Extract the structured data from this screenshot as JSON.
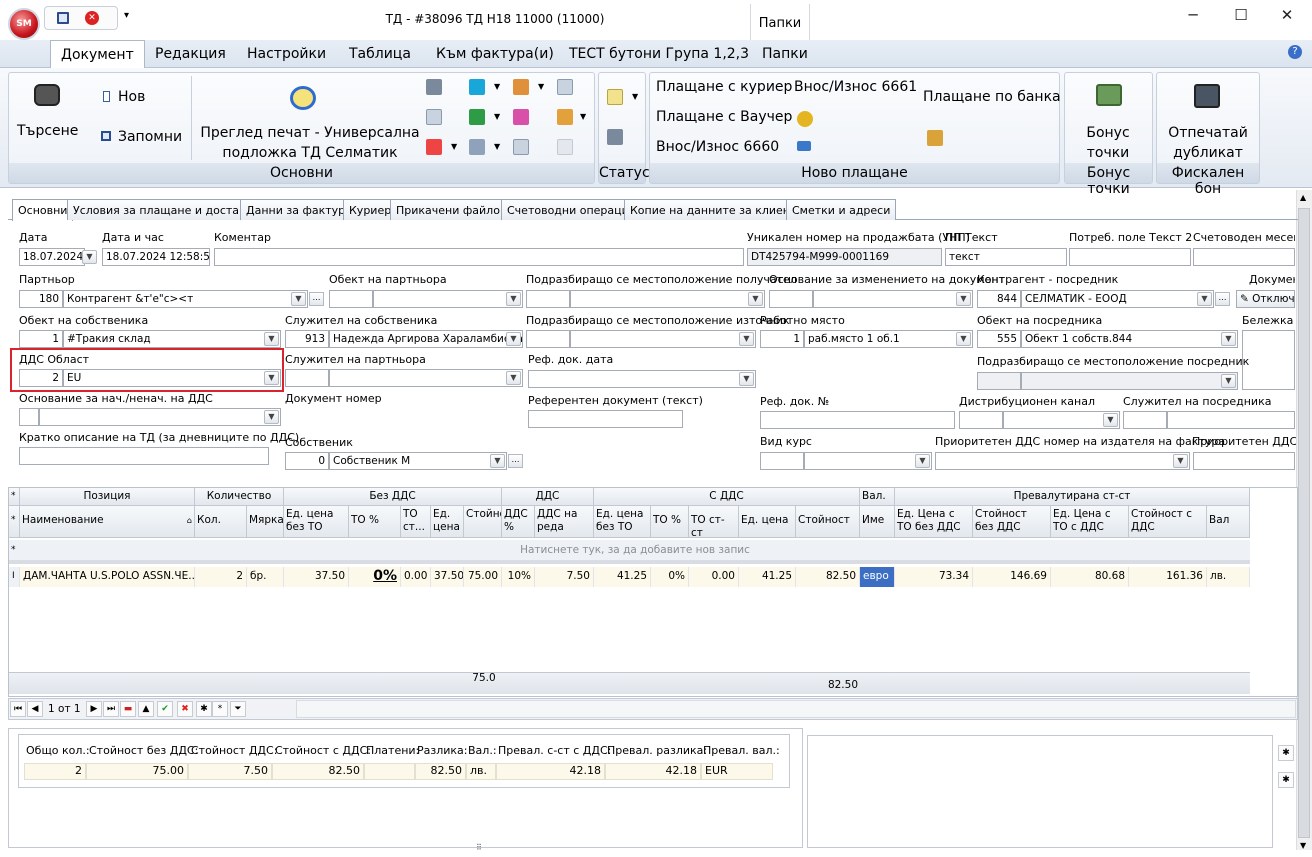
{
  "window": {
    "title": "ТД - #38096 ТД Н18 11000 (11000)",
    "logo": "SM",
    "papki": "Папки"
  },
  "menu": [
    "Документ",
    "Редакция",
    "Настройки",
    "Таблица",
    "Към фактура(и)",
    "ТЕСТ бутони Група 1,2,3",
    "Папки"
  ],
  "ribbon": {
    "search": "Търсене",
    "new": "Нов",
    "save": "Запомни",
    "preview": "Преглед печат - Универсална подложка ТД Селматик",
    "grp_main": "Основни",
    "grp_status": "Статус",
    "pay_courier": "Плащане с куриер",
    "pay_voucher": "Плащане с Ваучер",
    "inout1": "Внос/Износ 6660",
    "inout2": "Внос/Износ 6661",
    "pay_bank": "Плащане по банка",
    "grp_newpay": "Ново плащане",
    "bonus": "Бонус точки",
    "grp_bonus": "Бонус точки",
    "print_dup": "Отпечатай дубликат",
    "grp_fiscal": "Фискален бон"
  },
  "tabs": [
    "Основни",
    "Условия за плащане и доставка",
    "Данни за фактура",
    "Куриер",
    "Прикачени файлове",
    "Счетоводни операции",
    "Копие на данните за клиента",
    "Сметки и адреси"
  ],
  "form": {
    "date_lbl": "Дата",
    "date": "18.07.2024",
    "datetime_lbl": "Дата и час",
    "datetime": "18.07.2024 12:58:56",
    "comment_lbl": "Коментар",
    "unp_lbl": "Уникален номер на продажбата (УНП)",
    "unp": "DT425794-M999-0001169",
    "pptext_lbl": "ПП Текст",
    "pptext": "текст",
    "user_text2_lbl": "Потреб. поле Текст 2",
    "acc_month_lbl": "Счетоводен месец з",
    "partner_lbl": "Партньор",
    "partner_code": "180",
    "partner": "Контрагент &т'е\"с><т",
    "partner_obj_lbl": "Обект на партньора",
    "sub_loc_recv_lbl": "Подразбиращо се местоположение получател",
    "reason_lbl": "Основание за изменението на документ",
    "mediator_lbl": "Контрагент - посредник",
    "mediator_code": "844",
    "mediator": "СЕЛМАТИК - ЕООД",
    "doc_lbl": "Докумен",
    "switch_off": "Отключ",
    "own_obj_lbl": "Обект на собственика",
    "own_obj_code": "1",
    "own_obj": "#Тракия склад",
    "own_emp_lbl": "Служител на собственика",
    "own_emp_code": "913",
    "own_emp": "Надежда Аргирова Хараламбиева",
    "sub_loc_src_lbl": "Подразбиращо се местоположение източник",
    "workplace_lbl": "Работно място",
    "workplace_code": "1",
    "workplace": "раб.място 1 об.1",
    "med_obj_lbl": "Обект на посредника",
    "med_obj_code": "555",
    "med_obj": "Обект 1 собств.844",
    "note_lbl": "Бележка",
    "vat_area_lbl": "ДДС Област",
    "vat_area_code": "2",
    "vat_area": "EU",
    "partner_emp_lbl": "Служител на партньора",
    "ref_date_lbl": "Реф. док. дата",
    "sub_loc_med_lbl": "Подразбиращо се местоположение посредник",
    "vat_reason_lbl": "Основание за нач./ненач. на ДДС",
    "doc_no_lbl": "Документ номер",
    "ref_doc_text_lbl": "Референтен документ (текст)",
    "ref_doc_no_lbl": "Реф. док. №",
    "distr_lbl": "Дистрибуционен канал",
    "med_emp_lbl": "Служител на посредника",
    "short_desc_lbl": "Кратко описание на ТД (за дневниците по ДДС)",
    "owner_lbl": "Собственик",
    "owner_code": "0",
    "owner": "Собственик М",
    "rate_kind_lbl": "Вид курс",
    "prio_vat_lbl": "Приоритетен ДДС номер на издателя на фактура",
    "prio_vat2_lbl": "Приоритетен ДДС н"
  },
  "grid": {
    "groups": [
      "Позиция",
      "Количество",
      "Без ДДС",
      "ДДС",
      "С ДДС",
      "Вал.",
      "Превалутирана ст-ст"
    ],
    "cols": [
      "Наименование",
      "Кол.",
      "Мярка",
      "Ед. цена без ТО",
      "ТО %",
      "ТО ст...",
      "Ед. цена",
      "Стойност",
      "ДДС %",
      "ДДС на реда",
      "Ед. цена без ТО",
      "ТО %",
      "ТО ст-ст",
      "Ед. цена",
      "Стойност",
      "Име",
      "Ед. Цена с ТО без ДДС",
      "Стойност без ДДС",
      "Ед. Цена с ТО с ДДС",
      "Стойност с ДДС",
      "Вал"
    ],
    "add_row": "Натиснете тук, за да добавите нов запис",
    "row": [
      "ДАМ.ЧАНТА U.S.POLO ASSN.ЧЕ...",
      "2",
      "бр.",
      "37.50",
      "0%",
      "0.00",
      "37.50",
      "75.00",
      "10%",
      "7.50",
      "41.25",
      "0%",
      "0.00",
      "41.25",
      "82.50",
      "евро",
      "73.34",
      "146.69",
      "80.68",
      "161.36",
      "лв."
    ],
    "foot1": "75.0",
    "foot2": "82.50"
  },
  "nav": {
    "page": "1 от 1"
  },
  "summary": {
    "heads": [
      "Общо кол.:",
      "Стойност без ДДС:",
      "Стойност ДДС:",
      "Стойност с ДДС:",
      "Платени:",
      "Разлика:",
      "Вал.:",
      "Превал.  с-ст с ДДС:",
      "Превал. разлика:",
      "Превал. вал.:"
    ],
    "vals": [
      "2",
      "75.00",
      "7.50",
      "82.50",
      "",
      "82.50",
      "лв.",
      "42.18",
      "42.18",
      "EUR"
    ]
  }
}
